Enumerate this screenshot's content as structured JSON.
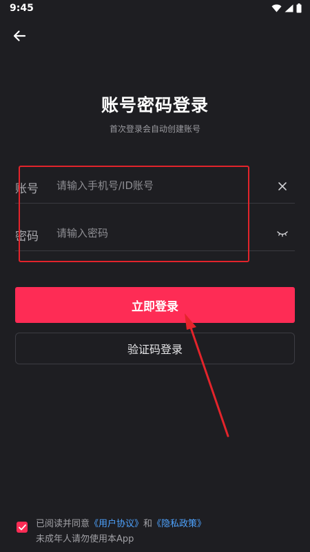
{
  "status_bar": {
    "time": "9:45"
  },
  "header": {
    "back_icon": "arrow-left-icon"
  },
  "title": "账号密码登录",
  "subtitle": "首次登录会自动创建账号",
  "account_field": {
    "label": "账号",
    "placeholder": "请输入手机号/ID账号",
    "value": "",
    "clear_icon": "close-icon"
  },
  "password_field": {
    "label": "密码",
    "placeholder": "请输入密码",
    "value": "",
    "visibility_icon": "eye-closed-icon"
  },
  "login_button": {
    "label": "立即登录"
  },
  "code_login_button": {
    "label": "验证码登录"
  },
  "agreement": {
    "prefix": "已阅读并同意",
    "user_agreement": "《用户协议》",
    "conjunction": "和",
    "privacy_policy": "《隐私政策》",
    "notice": "未成年人请勿使用本App",
    "checked": true
  },
  "colors": {
    "background": "#1e1e22",
    "primary": "#fe2c55",
    "link": "#4ea3ff",
    "annotation": "#e3242b"
  }
}
